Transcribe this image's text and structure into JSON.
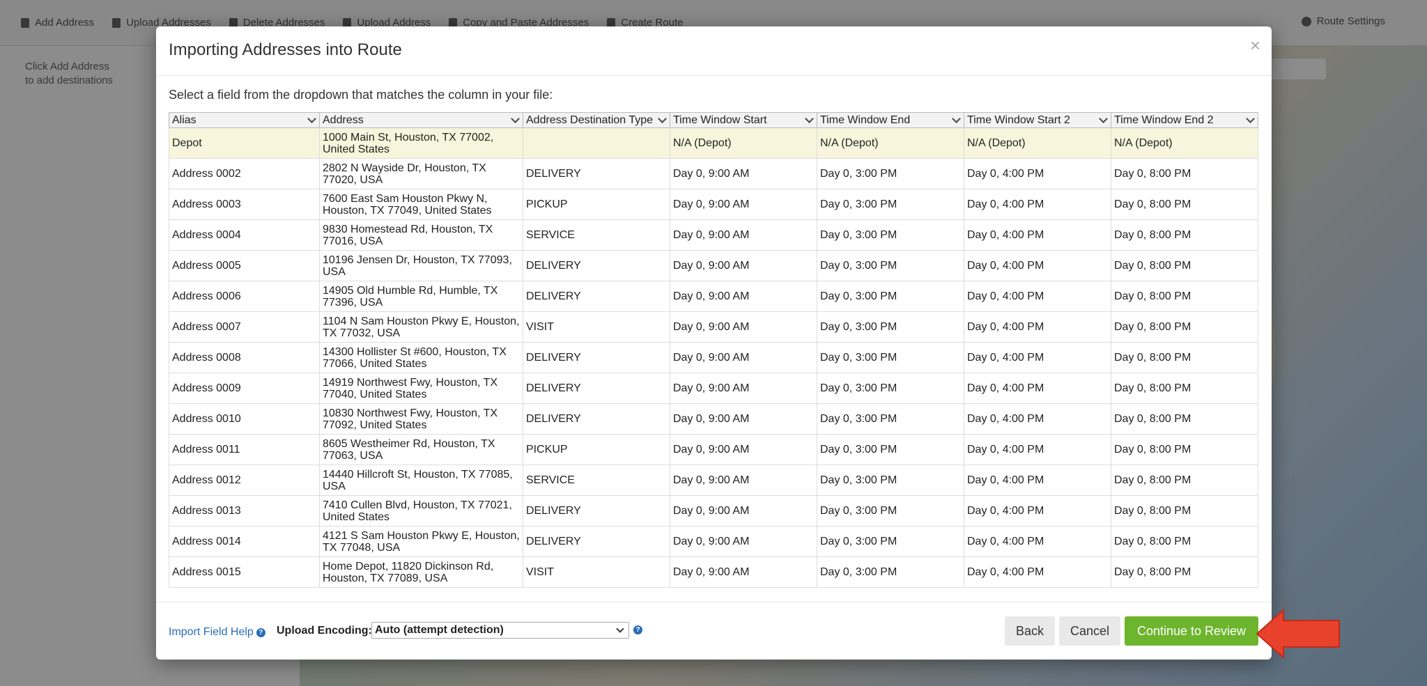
{
  "background": {
    "toolbar": [
      "Add Address",
      "Upload Addresses",
      "Delete Addresses",
      "Upload Address",
      "Copy and Paste Addresses",
      "Create Route"
    ],
    "settings_label": "Route Settings",
    "hint_line1": "Click Add Address",
    "hint_line2": "to add destinations"
  },
  "modal": {
    "title": "Importing Addresses into Route",
    "close_symbol": "×",
    "instructions": "Select a field from the dropdown that matches the column in your file:",
    "columns": [
      "Alias",
      "Address",
      "Address Destination Type",
      "Time Window Start",
      "Time Window End",
      "Time Window Start 2",
      "Time Window End 2"
    ],
    "rows": [
      [
        "Depot",
        "1000 Main St, Houston, TX 77002, United States",
        "",
        "N/A (Depot)",
        "N/A (Depot)",
        "N/A (Depot)",
        "N/A (Depot)"
      ],
      [
        "Address 0002",
        "2802 N Wayside Dr, Houston, TX 77020, USA",
        "DELIVERY",
        "Day 0, 9:00 AM",
        "Day 0, 3:00 PM",
        "Day 0, 4:00 PM",
        "Day 0, 8:00 PM"
      ],
      [
        "Address 0003",
        "7600 East Sam Houston Pkwy N, Houston, TX 77049, United States",
        "PICKUP",
        "Day 0, 9:00 AM",
        "Day 0, 3:00 PM",
        "Day 0, 4:00 PM",
        "Day 0, 8:00 PM"
      ],
      [
        "Address 0004",
        "9830 Homestead Rd, Houston, TX 77016, USA",
        "SERVICE",
        "Day 0, 9:00 AM",
        "Day 0, 3:00 PM",
        "Day 0, 4:00 PM",
        "Day 0, 8:00 PM"
      ],
      [
        "Address 0005",
        "10196 Jensen Dr, Houston, TX 77093, USA",
        "DELIVERY",
        "Day 0, 9:00 AM",
        "Day 0, 3:00 PM",
        "Day 0, 4:00 PM",
        "Day 0, 8:00 PM"
      ],
      [
        "Address 0006",
        "14905 Old Humble Rd, Humble, TX 77396, USA",
        "DELIVERY",
        "Day 0, 9:00 AM",
        "Day 0, 3:00 PM",
        "Day 0, 4:00 PM",
        "Day 0, 8:00 PM"
      ],
      [
        "Address 0007",
        "1104 N Sam Houston Pkwy E, Houston, TX 77032, USA",
        "VISIT",
        "Day 0, 9:00 AM",
        "Day 0, 3:00 PM",
        "Day 0, 4:00 PM",
        "Day 0, 8:00 PM"
      ],
      [
        "Address 0008",
        "14300 Hollister St #600, Houston, TX 77066, United States",
        "DELIVERY",
        "Day 0, 9:00 AM",
        "Day 0, 3:00 PM",
        "Day 0, 4:00 PM",
        "Day 0, 8:00 PM"
      ],
      [
        "Address 0009",
        "14919 Northwest Fwy, Houston, TX 77040, United States",
        "DELIVERY",
        "Day 0, 9:00 AM",
        "Day 0, 3:00 PM",
        "Day 0, 4:00 PM",
        "Day 0, 8:00 PM"
      ],
      [
        "Address 0010",
        "10830 Northwest Fwy, Houston, TX 77092, United States",
        "DELIVERY",
        "Day 0, 9:00 AM",
        "Day 0, 3:00 PM",
        "Day 0, 4:00 PM",
        "Day 0, 8:00 PM"
      ],
      [
        "Address 0011",
        "8605 Westheimer Rd, Houston, TX 77063, USA",
        "PICKUP",
        "Day 0, 9:00 AM",
        "Day 0, 3:00 PM",
        "Day 0, 4:00 PM",
        "Day 0, 8:00 PM"
      ],
      [
        "Address 0012",
        "14440 Hillcroft St, Houston, TX 77085, USA",
        "SERVICE",
        "Day 0, 9:00 AM",
        "Day 0, 3:00 PM",
        "Day 0, 4:00 PM",
        "Day 0, 8:00 PM"
      ],
      [
        "Address 0013",
        "7410 Cullen Blvd, Houston, TX 77021, United States",
        "DELIVERY",
        "Day 0, 9:00 AM",
        "Day 0, 3:00 PM",
        "Day 0, 4:00 PM",
        "Day 0, 8:00 PM"
      ],
      [
        "Address 0014",
        "4121 S Sam Houston Pkwy E, Houston, TX 77048, USA",
        "DELIVERY",
        "Day 0, 9:00 AM",
        "Day 0, 3:00 PM",
        "Day 0, 4:00 PM",
        "Day 0, 8:00 PM"
      ],
      [
        "Address 0015",
        "Home Depot, 11820 Dickinson Rd, Houston, TX 77089, USA",
        "VISIT",
        "Day 0, 9:00 AM",
        "Day 0, 3:00 PM",
        "Day 0, 4:00 PM",
        "Day 0, 8:00 PM"
      ]
    ],
    "footer": {
      "help_link": "Import Field Help",
      "help_icon": "question-circle-icon",
      "encoding_label": "Upload Encoding:",
      "encoding_value": "Auto (attempt detection)",
      "back_label": "Back",
      "cancel_label": "Cancel",
      "continue_label": "Continue to Review"
    }
  },
  "colors": {
    "continue_button": "#6cb52d",
    "depot_row": "#f7f6dc",
    "annotation_arrow": "#e8412c",
    "link": "#2a6db8"
  }
}
